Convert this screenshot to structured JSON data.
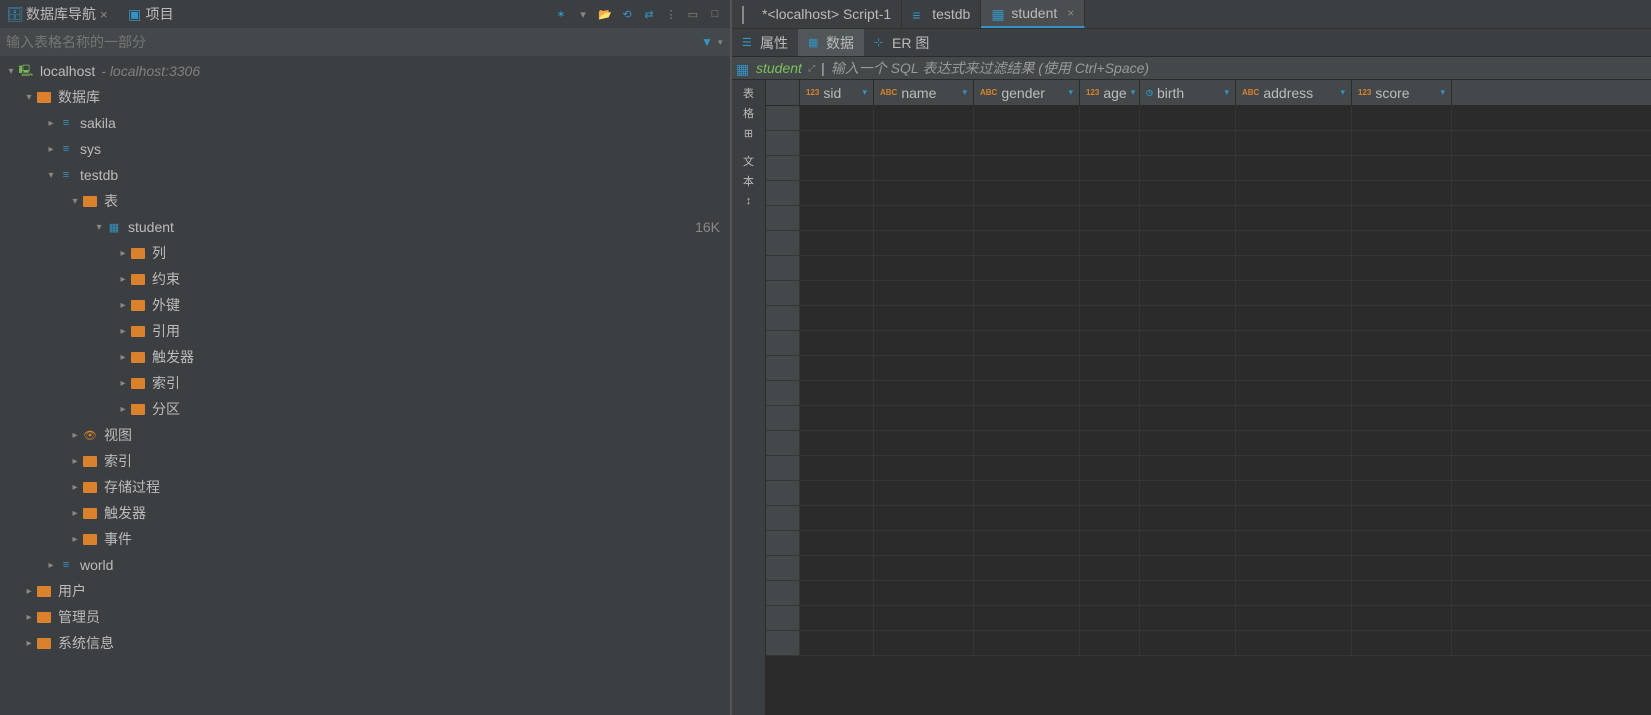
{
  "left": {
    "tabs": [
      {
        "label": "数据库导航"
      },
      {
        "label": "项目"
      }
    ],
    "filter_placeholder": "输入表格名称的一部分",
    "toolbar": {
      "wizard": "✶",
      "dd1": "▾",
      "open": "📂",
      "refresh": "⟲",
      "link": "⇄",
      "dots": "⋮",
      "min": "▭",
      "max": "□"
    },
    "tree": {
      "host": "localhost",
      "host_suffix": "- localhost:3306",
      "db_group": "数据库",
      "schemas": [
        {
          "name": "sakila",
          "open": false
        },
        {
          "name": "sys",
          "open": false
        },
        {
          "name": "testdb",
          "open": true,
          "children": {
            "tables_label": "表",
            "tables": [
              {
                "name": "student",
                "size": "16K",
                "open": true,
                "children": [
                  "列",
                  "约束",
                  "外键",
                  "引用",
                  "触发器",
                  "索引",
                  "分区"
                ]
              }
            ],
            "other": [
              "视图",
              "索引",
              "存储过程",
              "触发器",
              "事件"
            ]
          }
        },
        {
          "name": "world",
          "open": false
        }
      ],
      "top_other": [
        "用户",
        "管理员",
        "系统信息"
      ]
    }
  },
  "right": {
    "tabs": [
      {
        "label": "*<localhost> Script-1",
        "kind": "script",
        "active": false
      },
      {
        "label": "testdb",
        "kind": "db",
        "active": false
      },
      {
        "label": "student",
        "kind": "table",
        "active": true
      }
    ],
    "sub_tabs": [
      {
        "label": "属性",
        "active": false
      },
      {
        "label": "数据",
        "active": true
      },
      {
        "label": "ER 图",
        "active": false
      }
    ],
    "table_name": "student",
    "sql_hint": "输入一个 SQL 表达式来过滤结果 (使用 Ctrl+Space)",
    "columns": [
      {
        "name": "sid",
        "type": "123"
      },
      {
        "name": "name",
        "type": "ABC"
      },
      {
        "name": "gender",
        "type": "ABC"
      },
      {
        "name": "age",
        "type": "123"
      },
      {
        "name": "birth",
        "type": "CLK"
      },
      {
        "name": "address",
        "type": "ABC"
      },
      {
        "name": "score",
        "type": "123"
      }
    ],
    "gutter": [
      "表",
      "格",
      "⊞",
      "",
      "文",
      "本",
      "↕"
    ],
    "empty_rows": 22
  }
}
